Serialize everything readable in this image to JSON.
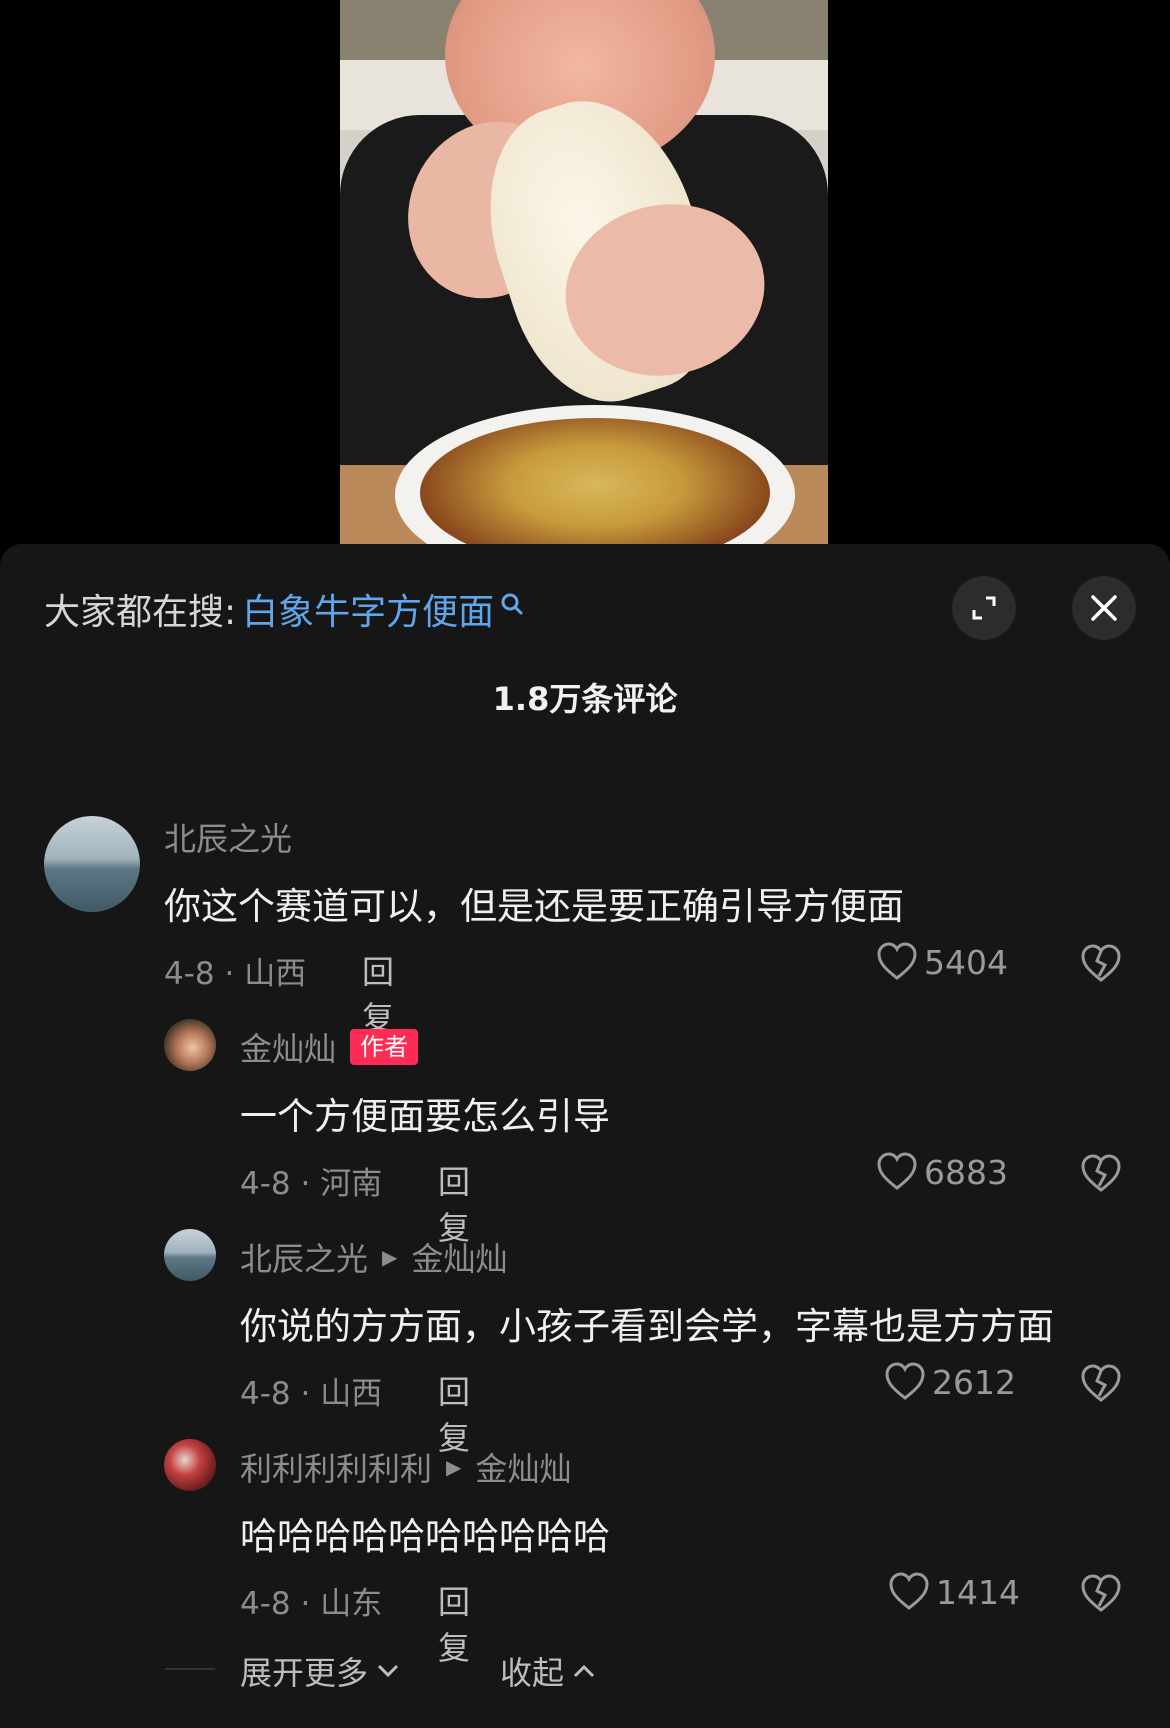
{
  "search": {
    "prefix": "大家都在搜:",
    "term": "白象牛字方便面"
  },
  "header": {
    "comment_count": "1.8万条评论"
  },
  "comments": [
    {
      "user": "北辰之光",
      "text": "你这个赛道可以，但是还是要正确引导方便面",
      "meta": "4-8 · 山西",
      "reply": "回复",
      "likes": "5404"
    },
    {
      "user": "金灿灿",
      "badge": "作者",
      "text": "一个方便面要怎么引导",
      "meta": "4-8 · 河南",
      "reply": "回复",
      "likes": "6883"
    },
    {
      "user": "北辰之光",
      "reply_to": "金灿灿",
      "text": "你说的方方面，小孩子看到会学，字幕也是方方面",
      "meta": "4-8 · 山西",
      "reply": "回复",
      "likes": "2612"
    },
    {
      "user": "利利利利利利",
      "reply_to": "金灿灿",
      "text": "哈哈哈哈哈哈哈哈哈哈",
      "meta": "4-8 · 山东",
      "reply": "回复",
      "likes": "1414"
    }
  ],
  "footer": {
    "expand_more": "展开更多",
    "collapse": "收起"
  },
  "colors": {
    "accent_link": "#5fa6ec",
    "author_badge": "#fe2c55",
    "sheet_bg": "#161616"
  }
}
